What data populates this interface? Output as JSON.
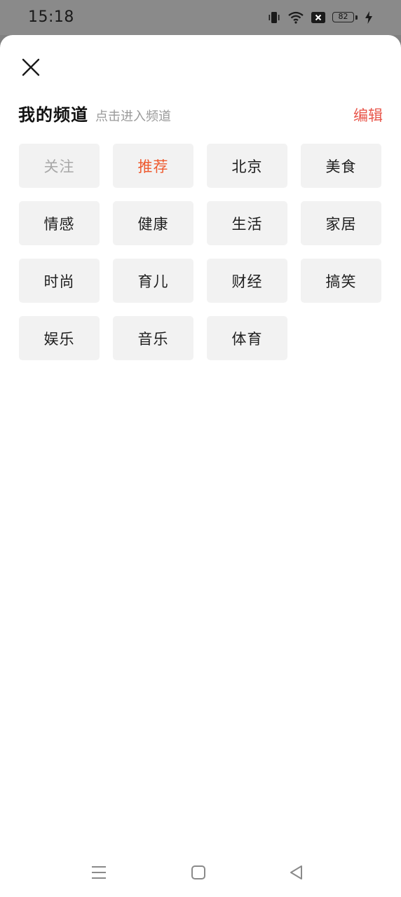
{
  "status_bar": {
    "time": "15:18",
    "battery_level": "82",
    "icons": [
      "vibrate-icon",
      "wifi-icon",
      "sim-blocked-icon",
      "battery-icon",
      "charging-bolt-icon"
    ]
  },
  "header": {
    "title": "我的频道",
    "subtitle": "点击进入频道",
    "edit_label": "编辑",
    "close_icon": "close-icon"
  },
  "channels": [
    {
      "label": "关注",
      "state": "disabled"
    },
    {
      "label": "推荐",
      "state": "active"
    },
    {
      "label": "北京",
      "state": "normal"
    },
    {
      "label": "美食",
      "state": "normal"
    },
    {
      "label": "情感",
      "state": "normal"
    },
    {
      "label": "健康",
      "state": "normal"
    },
    {
      "label": "生活",
      "state": "normal"
    },
    {
      "label": "家居",
      "state": "normal"
    },
    {
      "label": "时尚",
      "state": "normal"
    },
    {
      "label": "育儿",
      "state": "normal"
    },
    {
      "label": "财经",
      "state": "normal"
    },
    {
      "label": "搞笑",
      "state": "normal"
    },
    {
      "label": "娱乐",
      "state": "normal"
    },
    {
      "label": "音乐",
      "state": "normal"
    },
    {
      "label": "体育",
      "state": "normal"
    }
  ],
  "colors": {
    "accent_edit": "#e8554a",
    "active_channel": "#ee5a2f",
    "disabled_channel": "#a8a8a8",
    "chip_bg": "#f2f2f2"
  },
  "nav_bar": {
    "icons": [
      "menu-icon",
      "home-icon",
      "back-icon"
    ]
  }
}
